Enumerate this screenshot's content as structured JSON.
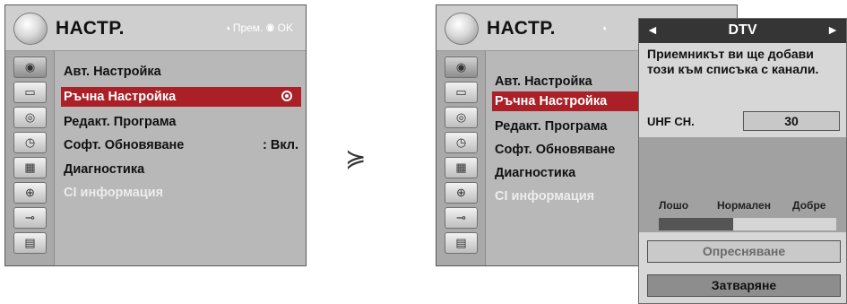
{
  "left_menu": {
    "title": "НАСТР.",
    "hint": "⬪ Прем. ◉ OK",
    "items": [
      {
        "label": "Авт. Настройка",
        "value": ""
      },
      {
        "label": "Ръчна Настройка",
        "value": ""
      },
      {
        "label": "Редакт. Програма",
        "value": ""
      },
      {
        "label": "Софт. Обновяване",
        "value": ": Вкл."
      },
      {
        "label": "Диагностика",
        "value": ""
      },
      {
        "label": "CI информация",
        "value": ""
      }
    ],
    "selected_index": 1,
    "sidebar_icons": [
      "satellite-dish-icon",
      "tv-screen-icon",
      "disc-icon",
      "clock-icon",
      "grid-icon",
      "lock-icon",
      "plug-icon",
      "film-icon"
    ]
  },
  "arrow": "≽",
  "right_menu": {
    "title": "НАСТР.",
    "hint": "⬪",
    "items": [
      {
        "label": "Авт. Настройка"
      },
      {
        "label": "Ръчна Настройка"
      },
      {
        "label": "Редакт. Програма"
      },
      {
        "label": "Софт. Обновяване"
      },
      {
        "label": "Диагностика"
      },
      {
        "label": "CI информация"
      }
    ],
    "selected_index": 1
  },
  "popup": {
    "left_arrow": "◄",
    "mode": "DTV",
    "right_arrow": "►",
    "message_line1": "Приемникът ви ще добави",
    "message_line2": "този към списъка с канали.",
    "uhf_label": "UHF CH.",
    "uhf_value": "30",
    "signal_labels": {
      "bad": "Лошо",
      "normal": "Нормален",
      "good": "Добре"
    },
    "signal_level": 0.42,
    "refresh_label": "Опресняване",
    "close_label": "Затваряне"
  },
  "colors": {
    "selection": "#ab1f27",
    "popup_bar": "#353535"
  }
}
